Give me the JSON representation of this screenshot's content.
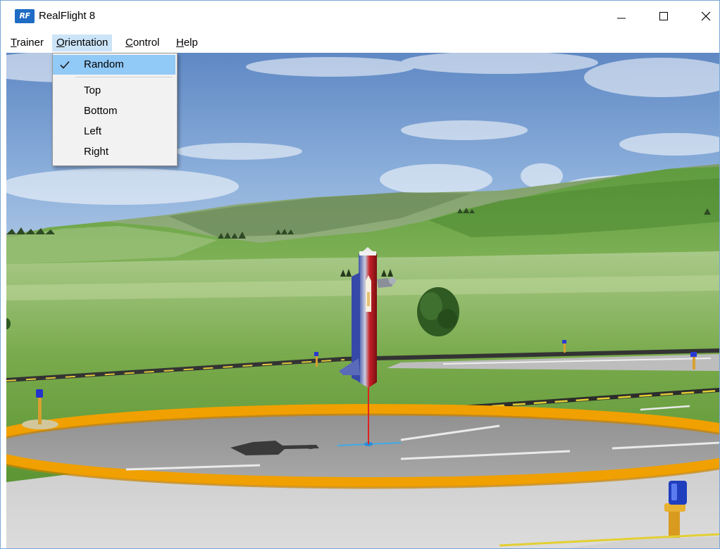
{
  "window": {
    "title": "RealFlight 8",
    "icon_text": "RF",
    "icon": "realflight-app-icon",
    "controls": [
      "minimize-icon",
      "maximize-icon",
      "close-icon"
    ]
  },
  "menubar": {
    "trainer": {
      "pre": "",
      "key": "T",
      "post": "rainer"
    },
    "orientation": {
      "pre": "",
      "key": "O",
      "post": "rientation"
    },
    "control": {
      "pre": "",
      "key": "C",
      "post": "ontrol"
    },
    "help": {
      "pre": "",
      "key": "H",
      "post": "elp"
    }
  },
  "orientation_menu": {
    "items": [
      {
        "label": "Random",
        "checked": true
      },
      {
        "label": "Top",
        "checked": false
      },
      {
        "label": "Bottom",
        "checked": false
      },
      {
        "label": "Left",
        "checked": false
      },
      {
        "label": "Right",
        "checked": false
      }
    ],
    "check_icon": "checkmark-icon"
  },
  "colors": {
    "menu_highlight": "#cce4f7",
    "checked_item": "#91c9f7",
    "helipad_ring": "#f0a000",
    "sky": "#7da4d2",
    "grass": "#5d9a2f"
  }
}
